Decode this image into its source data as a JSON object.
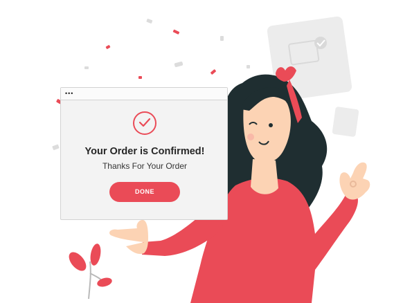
{
  "dialog": {
    "title": "Your Order is Confirmed!",
    "subtitle": "Thanks For Your Order",
    "done_label": "DONE",
    "window_dots": "•••"
  },
  "icons": {
    "check": "check-circle-icon",
    "window_controls": "window-dots-icon",
    "background_card": "order-card-icon",
    "confetti": "confetti-icon"
  },
  "colors": {
    "accent": "#ea4b57",
    "hair": "#1f2e31",
    "skin": "#fcd3b4",
    "window_bg": "#f3f3f3",
    "decor_grey": "#ececec"
  }
}
